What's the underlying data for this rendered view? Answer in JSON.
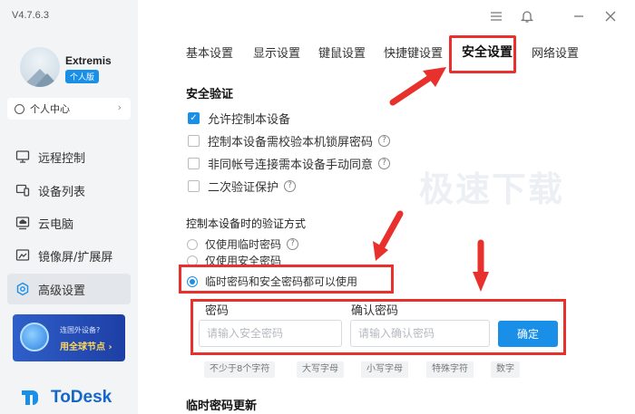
{
  "app": {
    "version": "V4.7.6.3",
    "brand": "ToDesk"
  },
  "user": {
    "name": "Extremis",
    "plan_badge": "个人版"
  },
  "sidebar": {
    "profile_label": "个人中心",
    "items": [
      {
        "label": "远程控制",
        "icon": "monitor-icon"
      },
      {
        "label": "设备列表",
        "icon": "devices-icon"
      },
      {
        "label": "云电脑",
        "icon": "cloud-pc-icon"
      },
      {
        "label": "镜像屏/扩展屏",
        "icon": "mirror-screen-icon"
      },
      {
        "label": "高级设置",
        "icon": "settings-icon",
        "active": true
      }
    ],
    "promo": {
      "line1": "连国外设备?",
      "line2": "用全球节点 ›"
    }
  },
  "tabs": [
    {
      "label": "基本设置"
    },
    {
      "label": "显示设置"
    },
    {
      "label": "键鼠设置"
    },
    {
      "label": "快捷键设置"
    },
    {
      "label": "安全设置",
      "active": true
    },
    {
      "label": "网络设置"
    }
  ],
  "security": {
    "title": "安全验证",
    "options": [
      {
        "label": "允许控制本设备",
        "checked": true,
        "help": false
      },
      {
        "label": "控制本设备需校验本机锁屏密码",
        "checked": false,
        "help": true
      },
      {
        "label": "非同帐号连接需本设备手动同意",
        "checked": false,
        "help": true
      },
      {
        "label": "二次验证保护",
        "checked": false,
        "help": true
      }
    ]
  },
  "watermark": "极速下载",
  "verify_method": {
    "title": "控制本设备时的验证方式",
    "options": [
      {
        "label": "仅使用临时密码",
        "selected": false
      },
      {
        "label": "仅使用安全密码",
        "selected": false
      },
      {
        "label": "临时密码和安全密码都可以使用",
        "selected": true
      }
    ]
  },
  "password_form": {
    "password_label": "密码",
    "password_placeholder": "请输入安全密码",
    "confirm_label": "确认密码",
    "confirm_placeholder": "请输入确认密码",
    "submit_label": "确定"
  },
  "requirements": [
    "不少于8个字符",
    "大写字母",
    "小写字母",
    "特殊字符",
    "数字"
  ],
  "temp_password_section": "临时密码更新",
  "colors": {
    "accent": "#1a8fe8",
    "annotation_red": "#e8312c",
    "sidebar_bg": "#f3f4f6"
  }
}
